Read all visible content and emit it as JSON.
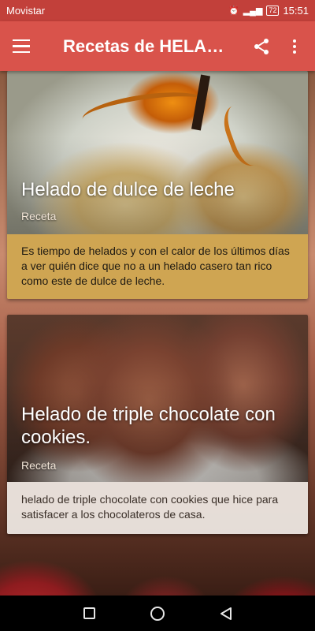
{
  "status_bar": {
    "carrier": "Movistar",
    "battery": "72",
    "time": "15:51"
  },
  "app_bar": {
    "title": "Recetas de HELADOS",
    "menu_icon": "hamburger-menu-icon",
    "share_icon": "share-icon",
    "more_icon": "more-vert-icon"
  },
  "recipes": [
    {
      "title": "Helado de dulce de leche",
      "category": "Receta",
      "description": "Es tiempo de helados y con el calor de los últimos días a ver quién dice que no a un helado casero tan rico como este de dulce de leche.",
      "accent": "#cfa552"
    },
    {
      "title": "Helado de triple chocolate con cookies.",
      "category": "Receta",
      "description": "helado de triple chocolate con cookies que hice para satisfacer a los chocolateros de casa.",
      "accent": "#eee8e2"
    }
  ],
  "nav_bar": {
    "recents_icon": "recents-square-icon",
    "home_icon": "home-circle-icon",
    "back_icon": "back-triangle-icon"
  },
  "colors": {
    "status_bar": "#c2403a",
    "app_bar": "#d9534b"
  }
}
